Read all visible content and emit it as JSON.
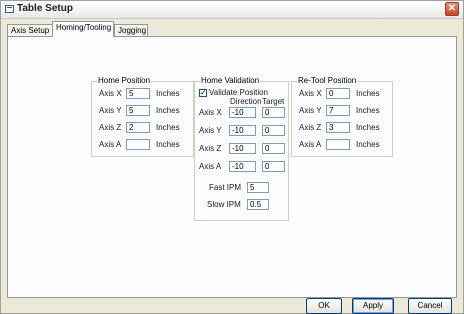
{
  "window": {
    "title": "Table Setup",
    "close_glyph": "✕"
  },
  "tabs": [
    {
      "label": "Axis Setup"
    },
    {
      "label": "Homing/Tooling"
    },
    {
      "label": "Jogging"
    }
  ],
  "home_position": {
    "title": "Home Position",
    "rows": [
      {
        "axis": "Axis X",
        "value": "5",
        "unit": "Inches"
      },
      {
        "axis": "Axis Y",
        "value": "5",
        "unit": "Inches"
      },
      {
        "axis": "Axis Z",
        "value": "2",
        "unit": "Inches"
      },
      {
        "axis": "Axis A",
        "value": "",
        "unit": "Inches"
      }
    ]
  },
  "home_validation": {
    "title": "Home Validation",
    "validate_label": "Validate Position",
    "validate_checked": "✓",
    "col_direction": "Direction",
    "col_target": "Target",
    "rows": [
      {
        "axis": "Axis X",
        "direction": "-10",
        "target": "0"
      },
      {
        "axis": "Axis Y",
        "direction": "-10",
        "target": "0"
      },
      {
        "axis": "Axis Z",
        "direction": "-10",
        "target": "0"
      },
      {
        "axis": "Axis A",
        "direction": "-10",
        "target": "0"
      }
    ],
    "fast_label": "Fast IPM",
    "fast_value": "5",
    "slow_label": "Slow IPM",
    "slow_value": "0.5"
  },
  "retool_position": {
    "title": "Re-Tool Position",
    "rows": [
      {
        "axis": "Axis X",
        "value": "0",
        "unit": "Inches"
      },
      {
        "axis": "Axis Y",
        "value": "7",
        "unit": "Inches"
      },
      {
        "axis": "Axis Z",
        "value": "3",
        "unit": "Inches"
      },
      {
        "axis": "Axis A",
        "value": "",
        "unit": "Inches"
      }
    ]
  },
  "buttons": {
    "ok": "OK",
    "apply": "Apply",
    "cancel": "Cancel"
  }
}
